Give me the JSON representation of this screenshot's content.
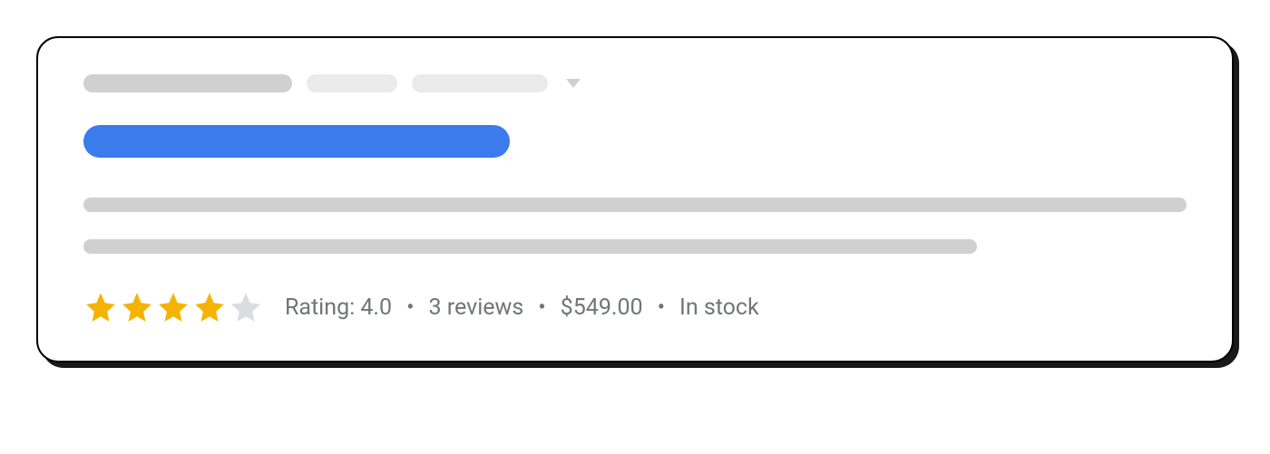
{
  "rating": {
    "label": "Rating: 4.0",
    "stars_filled": 4,
    "stars_total": 5
  },
  "reviews": {
    "text": "3 reviews"
  },
  "price": {
    "text": "$549.00"
  },
  "stock": {
    "text": "In stock"
  },
  "separator": "•"
}
